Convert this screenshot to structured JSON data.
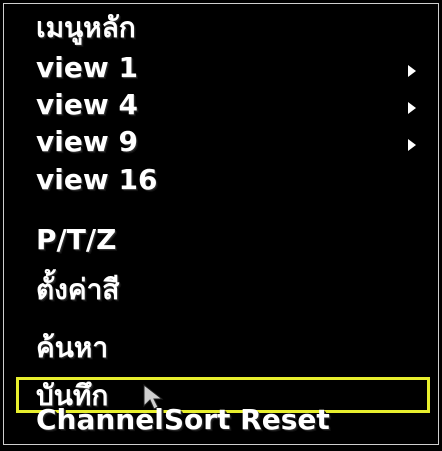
{
  "menu": {
    "title": "เมนูหลัก",
    "items": [
      {
        "label": "view 1",
        "submenu": true
      },
      {
        "label": "view 4",
        "submenu": true
      },
      {
        "label": "view 9",
        "submenu": true
      },
      {
        "label": "view 16",
        "submenu": false
      },
      {
        "label": "P/T/Z",
        "submenu": false
      },
      {
        "label": "ตั้งค่าสี",
        "submenu": false
      },
      {
        "label": "ค้นหา",
        "submenu": false
      },
      {
        "label": "บันทึก",
        "submenu": false,
        "selected": true
      },
      {
        "label": "ChannelSort Reset",
        "submenu": false
      }
    ],
    "highlight_color": "#e8ef2e",
    "arrow_icon": "triangle-right-icon",
    "cursor_icon": "mouse-pointer-icon"
  }
}
